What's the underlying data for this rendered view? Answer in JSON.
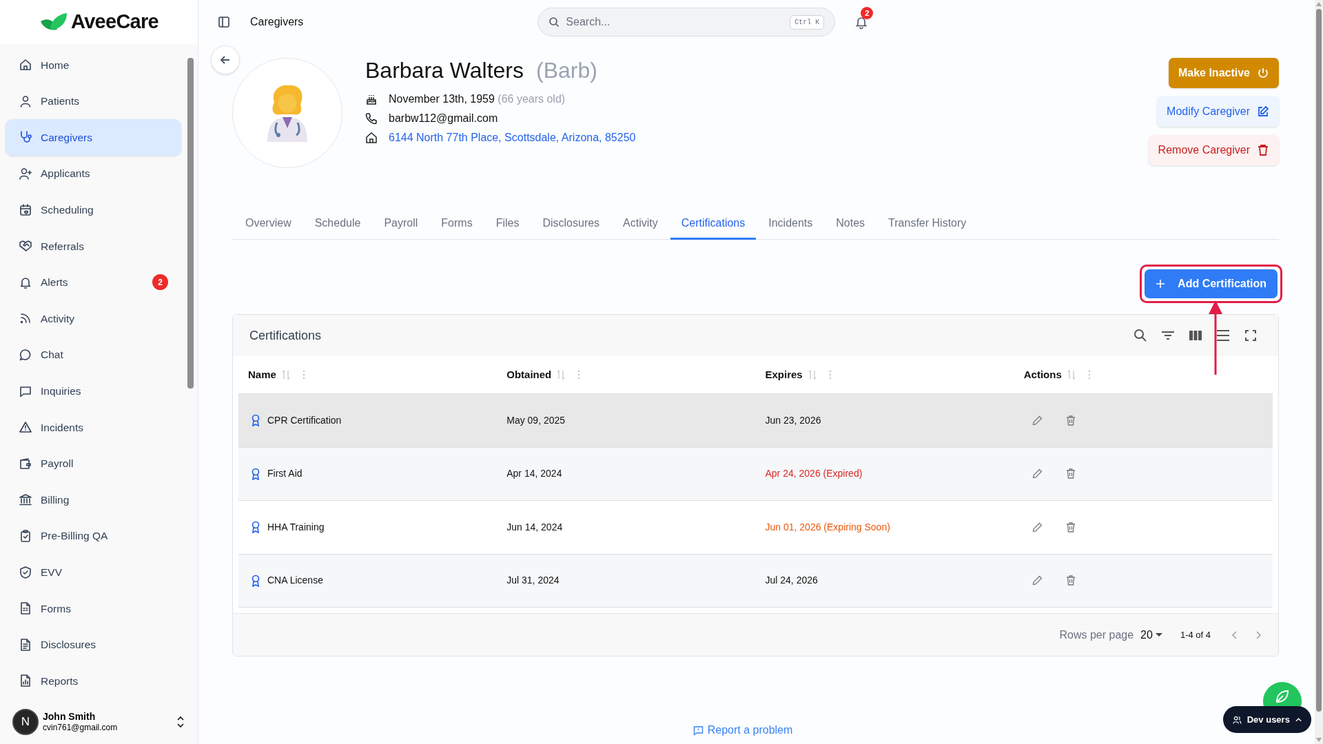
{
  "app": {
    "logo": "AveeCare"
  },
  "sidebar": {
    "items": [
      {
        "label": "Home",
        "selected": false
      },
      {
        "label": "Patients",
        "selected": false
      },
      {
        "label": "Caregivers",
        "selected": true
      },
      {
        "label": "Applicants",
        "selected": false
      },
      {
        "label": "Scheduling",
        "selected": false
      },
      {
        "label": "Referrals",
        "selected": false
      },
      {
        "label": "Alerts",
        "selected": false,
        "badge": "2"
      },
      {
        "label": "Activity",
        "selected": false
      },
      {
        "label": "Chat",
        "selected": false
      },
      {
        "label": "Inquiries",
        "selected": false
      },
      {
        "label": "Incidents",
        "selected": false
      },
      {
        "label": "Payroll",
        "selected": false
      },
      {
        "label": "Billing",
        "selected": false
      },
      {
        "label": "Pre-Billing QA",
        "selected": false
      },
      {
        "label": "EVV",
        "selected": false
      },
      {
        "label": "Forms",
        "selected": false
      },
      {
        "label": "Disclosures",
        "selected": false
      },
      {
        "label": "Reports",
        "selected": false
      }
    ],
    "user": {
      "initial": "N",
      "name": "John Smith",
      "email": "cvin761@gmail.com"
    }
  },
  "header": {
    "breadcrumb": "Caregivers",
    "search": {
      "placeholder": "Search...",
      "shortcut": "Ctrl K"
    },
    "notifications": "2"
  },
  "profile": {
    "name": "Barbara Walters",
    "nickname": "(Barb)",
    "birthdate": "November 13th, 1959",
    "age": "(66 years old)",
    "email": "barbw112@gmail.com",
    "address": "6144 North 77th Place, Scottsdale, Arizona, 85250"
  },
  "actions": [
    {
      "label": "Make Inactive",
      "kind": "warning"
    },
    {
      "label": "Modify Caregiver",
      "kind": "primary"
    },
    {
      "label": "Remove Caregiver",
      "kind": "danger"
    }
  ],
  "tabs": [
    {
      "label": "Overview",
      "selected": false
    },
    {
      "label": "Schedule",
      "selected": false
    },
    {
      "label": "Payroll",
      "selected": false
    },
    {
      "label": "Forms",
      "selected": false
    },
    {
      "label": "Files",
      "selected": false
    },
    {
      "label": "Disclosures",
      "selected": false
    },
    {
      "label": "Activity",
      "selected": false
    },
    {
      "label": "Certifications",
      "selected": true
    },
    {
      "label": "Incidents",
      "selected": false
    },
    {
      "label": "Notes",
      "selected": false
    },
    {
      "label": "Transfer History",
      "selected": false
    }
  ],
  "add_button": {
    "label": "Add Certification",
    "highlighted": true
  },
  "table": {
    "title": "Certifications",
    "columns": [
      "Name",
      "Obtained",
      "Expires",
      "Actions"
    ],
    "rows": [
      {
        "name": "CPR Certification",
        "obtained": "May 09, 2025",
        "expires": "Jun 23, 2026",
        "expired": false,
        "expiring_soon": false,
        "selected": true
      },
      {
        "name": "First Aid",
        "obtained": "Apr 14, 2024",
        "expires": "Apr 24, 2026 (Expired)",
        "expired": true,
        "expiring_soon": false,
        "selected": false
      },
      {
        "name": "HHA Training",
        "obtained": "Jun 14, 2024",
        "expires": "Jun 01, 2026 (Expiring Soon)",
        "expired": false,
        "expiring_soon": true,
        "selected": false
      },
      {
        "name": "CNA License",
        "obtained": "Jul 31, 2024",
        "expires": "Jul 24, 2026",
        "expired": false,
        "expiring_soon": false,
        "selected": false
      }
    ],
    "pagination": {
      "rows_per_page_label": "Rows per page",
      "rows_per_page": "20",
      "range": "1-4 of 4"
    }
  },
  "footer": {
    "report_link": "Report a problem"
  },
  "dev_users": {
    "label": "Dev users"
  }
}
